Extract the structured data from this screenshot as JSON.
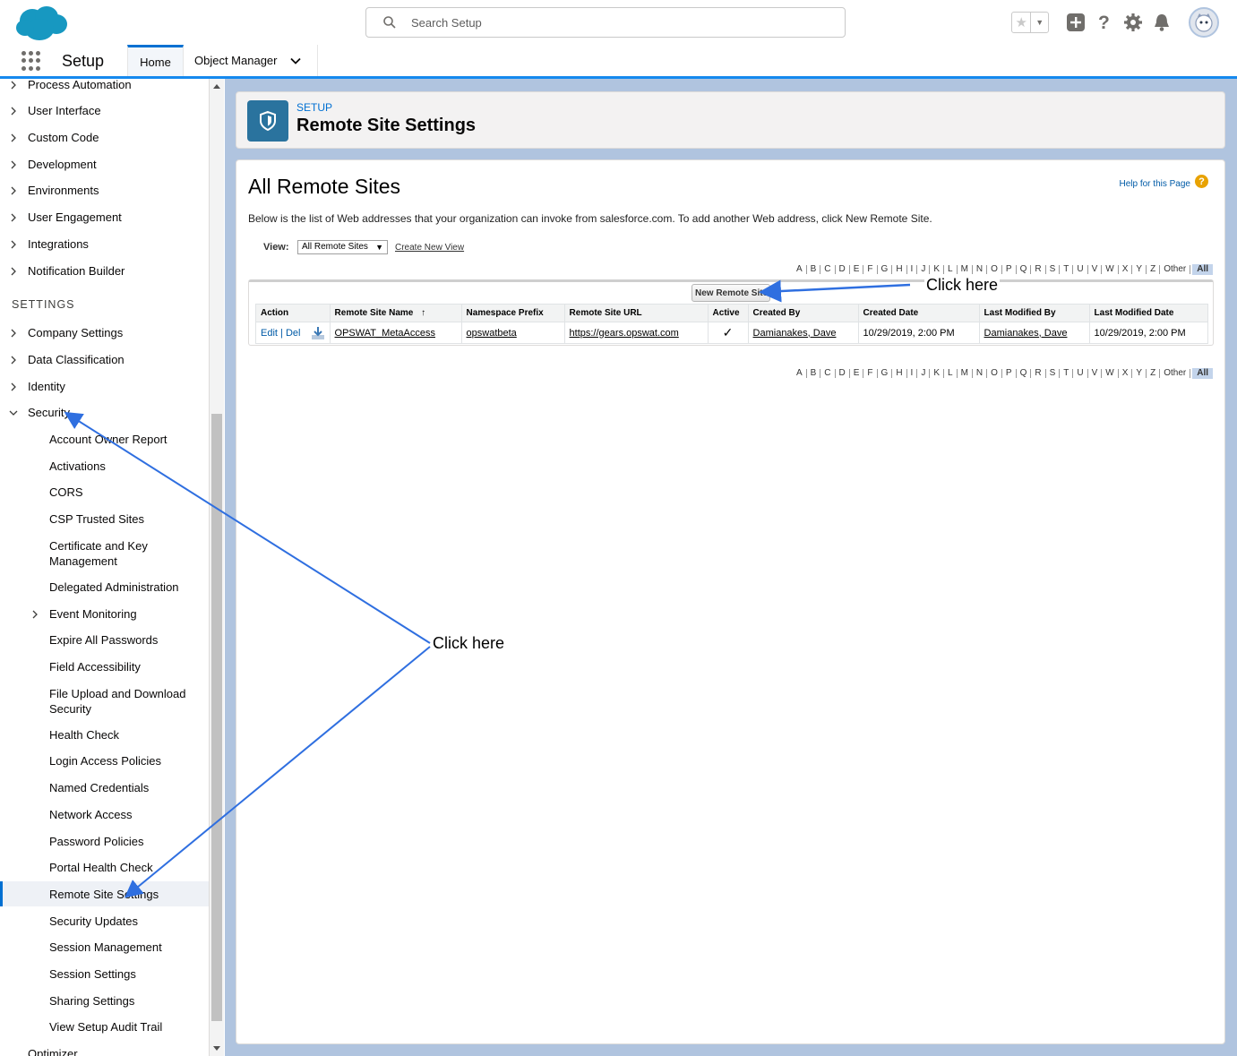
{
  "header": {
    "search_placeholder": "Search Setup",
    "icons": [
      "salesforce-cloud-logo",
      "search-icon",
      "star-icon",
      "add-icon",
      "help-icon",
      "gear-icon",
      "bell-icon",
      "avatar"
    ]
  },
  "context_bar": {
    "app_name": "Setup",
    "tabs": [
      {
        "label": "Home"
      },
      {
        "label": "Object Manager"
      }
    ]
  },
  "sidebar": {
    "top_items": [
      "Process Automation",
      "User Interface",
      "Custom Code",
      "Development",
      "Environments",
      "User Engagement",
      "Integrations",
      "Notification Builder"
    ],
    "section_heading": "SETTINGS",
    "settings_items": [
      "Company Settings",
      "Data Classification",
      "Identity",
      "Security"
    ],
    "security_children": [
      "Account Owner Report",
      "Activations",
      "CORS",
      "CSP Trusted Sites",
      "Certificate and Key Management",
      "Delegated Administration",
      "Event Monitoring",
      "Expire All Passwords",
      "Field Accessibility",
      "File Upload and Download Security",
      "Health Check",
      "Login Access Policies",
      "Named Credentials",
      "Network Access",
      "Password Policies",
      "Portal Health Check",
      "Remote Site Settings",
      "Security Updates",
      "Session Management",
      "Session Settings",
      "Sharing Settings",
      "View Setup Audit Trail"
    ],
    "bottom_item": "Optimizer",
    "selected": "Remote Site Settings"
  },
  "page_header": {
    "eyebrow": "SETUP",
    "title": "Remote Site Settings"
  },
  "content": {
    "heading": "All Remote Sites",
    "help_link": "Help for this Page",
    "help_icon": "?",
    "description": "Below is the list of Web addresses that your organization can invoke from salesforce.com. To add another Web address, click New Remote Site.",
    "view_label": "View:",
    "view_value": "All Remote Sites",
    "create_view": "Create New View",
    "alphabet": [
      "A",
      "B",
      "C",
      "D",
      "E",
      "F",
      "G",
      "H",
      "I",
      "J",
      "K",
      "L",
      "M",
      "N",
      "O",
      "P",
      "Q",
      "R",
      "S",
      "T",
      "U",
      "V",
      "W",
      "X",
      "Y",
      "Z",
      "Other",
      "All"
    ],
    "new_button": "New Remote Site",
    "columns": [
      "Action",
      "Remote Site Name",
      "Namespace Prefix",
      "Remote Site URL",
      "Active",
      "Created By",
      "Created Date",
      "Last Modified By",
      "Last Modified Date"
    ],
    "sort_indicator": "↑",
    "rows": [
      {
        "edit": "Edit",
        "sep": "|",
        "del": "Del",
        "name": "OPSWAT_MetaAccess",
        "namespace": "opswatbeta",
        "url": "https://gears.opswat.com",
        "active": "✓",
        "created_by": "Damianakes, Dave",
        "created_date": "10/29/2019, 2:00 PM",
        "modified_by": "Damianakes, Dave",
        "modified_date": "10/29/2019, 2:00 PM"
      }
    ]
  },
  "annotations": {
    "click_here_1": "Click here",
    "click_here_2": "Click here",
    "arrow_color": "#2f6fe0"
  },
  "colors": {
    "brand_blue": "#1589ee",
    "page_bg": "#b0c4df",
    "header_icon": "#2a739e"
  }
}
